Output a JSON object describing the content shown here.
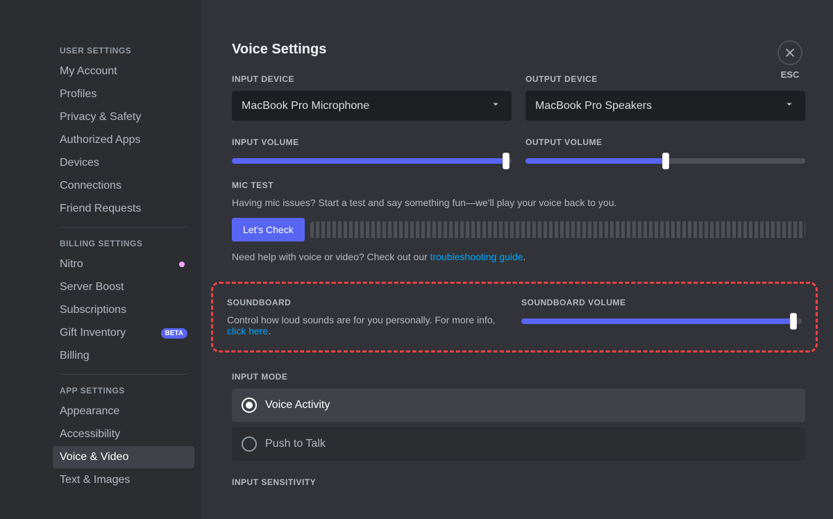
{
  "sidebar": {
    "sections": [
      {
        "header": "User Settings",
        "items": [
          {
            "label": "My Account"
          },
          {
            "label": "Profiles"
          },
          {
            "label": "Privacy & Safety"
          },
          {
            "label": "Authorized Apps"
          },
          {
            "label": "Devices"
          },
          {
            "label": "Connections"
          },
          {
            "label": "Friend Requests"
          }
        ]
      },
      {
        "header": "Billing Settings",
        "items": [
          {
            "label": "Nitro",
            "nitroIcon": true
          },
          {
            "label": "Server Boost"
          },
          {
            "label": "Subscriptions"
          },
          {
            "label": "Gift Inventory",
            "badge": "BETA"
          },
          {
            "label": "Billing"
          }
        ]
      },
      {
        "header": "App Settings",
        "items": [
          {
            "label": "Appearance"
          },
          {
            "label": "Accessibility"
          },
          {
            "label": "Voice & Video",
            "active": true
          },
          {
            "label": "Text & Images"
          }
        ]
      }
    ]
  },
  "close": {
    "label": "ESC"
  },
  "page": {
    "title": "Voice Settings",
    "inputDevice": {
      "label": "Input Device",
      "value": "MacBook Pro Microphone"
    },
    "outputDevice": {
      "label": "Output Device",
      "value": "MacBook Pro Speakers"
    },
    "inputVolume": {
      "label": "Input Volume",
      "percent": 98
    },
    "outputVolume": {
      "label": "Output Volume",
      "percent": 50
    },
    "micTest": {
      "label": "Mic Test",
      "help": "Having mic issues? Start a test and say something fun—we'll play your voice back to you.",
      "button": "Let's Check"
    },
    "troubleshooting": {
      "prefix": "Need help with voice or video? Check out our ",
      "link": "troubleshooting guide",
      "suffix": "."
    },
    "soundboard": {
      "label": "Soundboard",
      "help1": "Control how loud sounds are for you personally. For more info, ",
      "link": "click here",
      "help2": "."
    },
    "soundboardVolume": {
      "label": "Soundboard Volume",
      "percent": 97
    },
    "inputMode": {
      "label": "Input Mode",
      "options": [
        {
          "label": "Voice Activity",
          "selected": true
        },
        {
          "label": "Push to Talk",
          "selected": false
        }
      ]
    },
    "inputSensitivity": {
      "label": "Input Sensitivity"
    }
  }
}
